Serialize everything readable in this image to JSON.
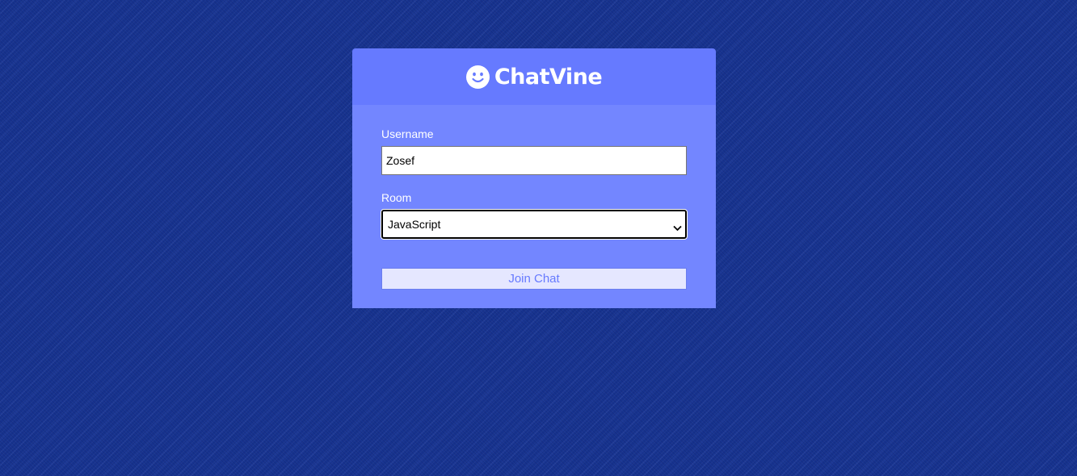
{
  "header": {
    "logo_icon": "smiley-face-icon",
    "title": "ChatVine"
  },
  "form": {
    "username_label": "Username",
    "username_value": "Zosef",
    "room_label": "Room",
    "room_selected": "JavaScript",
    "submit_label": "Join Chat"
  },
  "colors": {
    "background": "#17338f",
    "header": "#667aff",
    "panel": "#7386ff",
    "button_bg": "#e5e7ff",
    "button_text": "#667aff"
  }
}
